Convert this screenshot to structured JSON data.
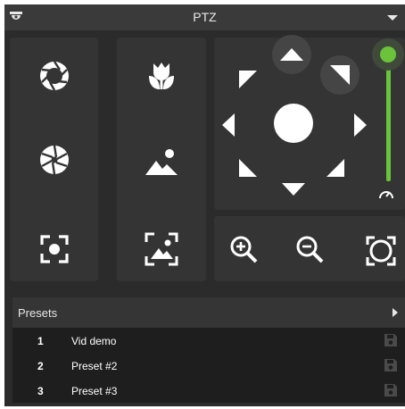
{
  "header": {
    "title": "PTZ",
    "camera_icon": "camera-icon",
    "menu_icon": "chevron-down-icon"
  },
  "controls": {
    "left_column": [
      "iris-open-icon",
      "iris-close-icon",
      "focus-frame-icon"
    ],
    "middle_column": [
      "macro-focus-icon",
      "landscape-focus-icon",
      "image-focus-icon"
    ],
    "pan_tilt": [
      "arrow-up-icon",
      "arrow-down-icon",
      "arrow-left-icon",
      "arrow-right-icon",
      "arrow-up-left-icon",
      "arrow-up-right-icon",
      "arrow-down-left-icon",
      "arrow-down-right-icon",
      "center-icon"
    ],
    "speed": {
      "level": 1.0,
      "accent": "#6ac33a",
      "icon": "speedometer-icon"
    },
    "zoom": [
      "zoom-in-icon",
      "zoom-out-icon",
      "zoom-fit-icon"
    ]
  },
  "presets": {
    "label": "Presets",
    "items": [
      {
        "num": "1",
        "name": "Vid demo"
      },
      {
        "num": "2",
        "name": "Preset #2"
      },
      {
        "num": "3",
        "name": "Preset #3"
      }
    ]
  }
}
